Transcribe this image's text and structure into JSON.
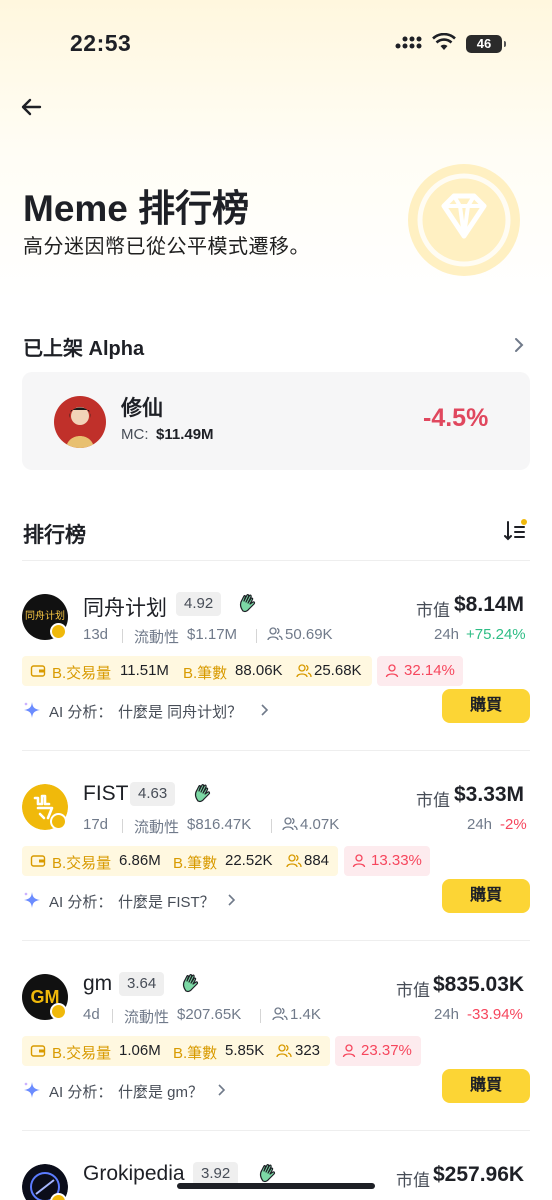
{
  "status_bar": {
    "time": "22:53",
    "battery": "46"
  },
  "header": {
    "title": "Meme 排行榜",
    "subtitle": "高分迷因幣已從公平模式遷移。"
  },
  "listed": {
    "title": "已上架 Alpha",
    "token": {
      "name": "修仙",
      "mc_label": "MC:",
      "mc_value": "$11.49M",
      "change": "-4.5%"
    }
  },
  "ranking": {
    "title": "排行榜",
    "tokens": [
      {
        "name": "同舟计划",
        "score": "4.92",
        "age": "13d",
        "liquidity_label": "流動性",
        "liquidity": "$1.17M",
        "holders": "50.69K",
        "mc_label": "市值",
        "mc": "$8.14M",
        "h24_label": "24h",
        "h24": "+75.24%",
        "volume_label": "B.交易量",
        "volume": "11.51M",
        "txn_label": "B.筆數",
        "txns": "88.06K",
        "traders": "25.68K",
        "pct": "32.14%",
        "ai_prefix": "AI 分析：",
        "ai_question": "什麼是 同舟计划？",
        "buy": "購買",
        "avatar_text": "同舟计划"
      },
      {
        "name": "FIST",
        "score": "4.63",
        "age": "17d",
        "liquidity_label": "流動性",
        "liquidity": "$816.47K",
        "holders": "4.07K",
        "mc_label": "市值",
        "mc": "$3.33M",
        "h24_label": "24h",
        "h24": "-2%",
        "volume_label": "B.交易量",
        "volume": "6.86M",
        "txn_label": "B.筆數",
        "txns": "22.52K",
        "traders": "884",
        "pct": "13.33%",
        "ai_prefix": "AI 分析：",
        "ai_question": "什麼是 FIST？",
        "buy": "購買",
        "avatar_text": "☖"
      },
      {
        "name": "gm",
        "score": "3.64",
        "age": "4d",
        "liquidity_label": "流動性",
        "liquidity": "$207.65K",
        "holders": "1.4K",
        "mc_label": "市值",
        "mc": "$835.03K",
        "h24_label": "24h",
        "h24": "-33.94%",
        "volume_label": "B.交易量",
        "volume": "1.06M",
        "txn_label": "B.筆數",
        "txns": "5.85K",
        "traders": "323",
        "pct": "23.37%",
        "ai_prefix": "AI 分析：",
        "ai_question": "什麼是 gm？",
        "buy": "購買",
        "avatar_text": "GM"
      },
      {
        "name": "Grokipedia",
        "score": "3.92",
        "mc_label": "市值",
        "mc": "$257.96K"
      }
    ]
  },
  "colors": {
    "accent": "#FCD535",
    "positive": "#2EBD85",
    "negative": "#F6465D",
    "badge": "#F0B90B"
  },
  "icons": [
    "back-arrow-icon",
    "diamond-icon",
    "chevron-right-icon",
    "sort-icon",
    "wave-hand-icon",
    "holders-icon",
    "wallet-icon",
    "sparkle-icon"
  ]
}
